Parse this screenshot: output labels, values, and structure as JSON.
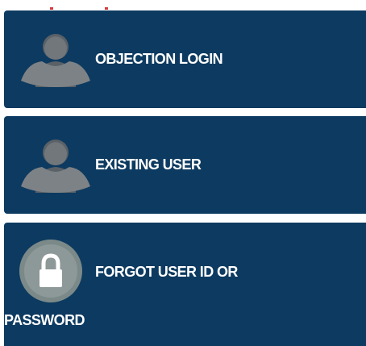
{
  "menu": {
    "items": [
      {
        "label": "OBJECTION LOGIN",
        "icon": "users-icon"
      },
      {
        "label": "EXISTING USER",
        "icon": "users-icon"
      },
      {
        "label_line1": "FORGOT USER ID OR",
        "label_line2": "PASSWORD",
        "icon": "lock-icon"
      }
    ]
  },
  "colors": {
    "card_background": "#0d3a60",
    "icon_gray": "#6d7377",
    "accent_red": "#d63a3a"
  }
}
